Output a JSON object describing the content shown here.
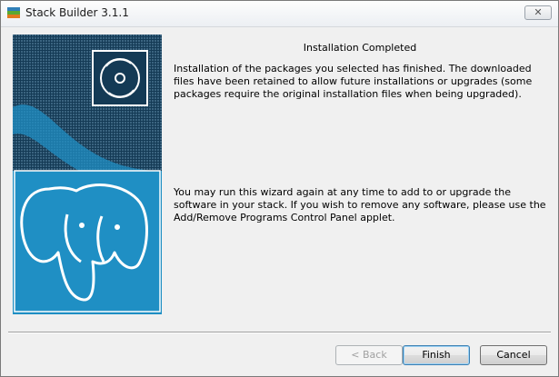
{
  "window": {
    "title": "Stack Builder 3.1.1",
    "close_glyph": "✕"
  },
  "content": {
    "heading": "Installation Completed",
    "paragraph1": "Installation of the packages you selected has finished. The downloaded files have been retained to allow future installations or upgrades (some packages require the original installation files when being upgraded).",
    "paragraph2": "You may run this wizard again at any time to add to or upgrade the software in your stack. If you wish to remove any software, please use the Add/Remove Programs Control Panel applet."
  },
  "buttons": {
    "back_label": "< Back",
    "finish_label": "Finish",
    "cancel_label": "Cancel"
  },
  "colors": {
    "panel_dark": "#143a55",
    "panel_blue": "#1f8fc4",
    "default_button_border": "#3c7fb1"
  },
  "icons": {
    "app": "stack-builder-app-icon",
    "disc": "disc-icon",
    "logo": "postgresql-elephant-logo"
  }
}
